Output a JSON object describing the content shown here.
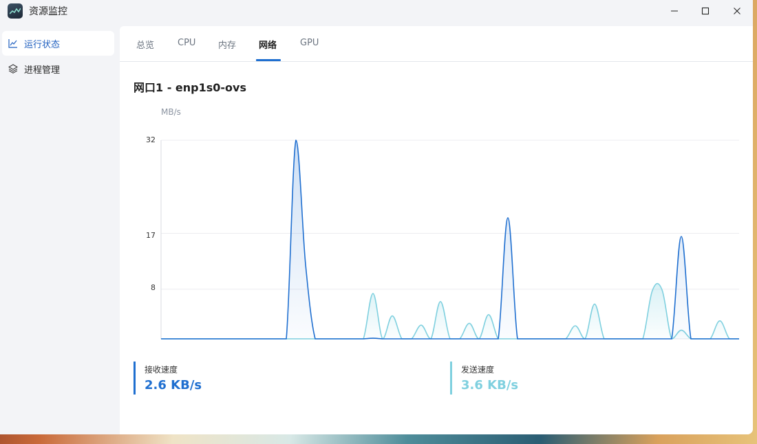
{
  "window": {
    "title": "资源监控",
    "app_icon": "monitor-chart-icon",
    "controls": [
      "minimize-icon",
      "maximize-icon",
      "close-icon"
    ]
  },
  "sidebar": {
    "items": [
      {
        "label": "运行状态",
        "icon": "line-chart-icon",
        "active": true
      },
      {
        "label": "进程管理",
        "icon": "layers-icon",
        "active": false
      }
    ]
  },
  "tabs": [
    {
      "label": "总览"
    },
    {
      "label": "CPU"
    },
    {
      "label": "内存"
    },
    {
      "label": "网络",
      "active": true
    },
    {
      "label": "GPU"
    }
  ],
  "network": {
    "interface_title": "网口1 - enp1s0-ovs",
    "unit": "MB/s",
    "receive_label": "接收速度",
    "receive_value": "2.6 KB/s",
    "send_label": "发送速度",
    "send_value": "3.6 KB/s"
  },
  "colors": {
    "accent": "#1f6fd0",
    "receive": "#1f6fd0",
    "send": "#7fd0df",
    "grid": "#ececf0"
  },
  "chart_data": {
    "type": "area",
    "ylabel": "MB/s",
    "yticks": [
      32,
      17,
      8
    ],
    "ylim": [
      0,
      32
    ],
    "xlim": [
      0,
      60
    ],
    "grid": true,
    "series": [
      {
        "name": "接收速度",
        "color": "#1f6fd0",
        "values": [
          0,
          0,
          0,
          0,
          0,
          0,
          0,
          0,
          0,
          0,
          0,
          0,
          0,
          0,
          32,
          12,
          0,
          0,
          0,
          0,
          0,
          0,
          0.1,
          0,
          0,
          0,
          0,
          0,
          0,
          0,
          0,
          0,
          0,
          0,
          0,
          0,
          19.5,
          0,
          0,
          0,
          0,
          0,
          0,
          0,
          0,
          0,
          0,
          0,
          0,
          0,
          0,
          0,
          0,
          0,
          16.5,
          0,
          0,
          0,
          0,
          0,
          0
        ]
      },
      {
        "name": "发送速度",
        "color": "#7fd0df",
        "values": [
          0,
          0,
          0,
          0,
          0,
          0,
          0,
          0,
          0,
          0,
          0,
          0,
          0,
          0,
          0,
          0,
          0,
          0,
          0,
          0,
          0,
          0,
          7.3,
          0,
          3.7,
          0,
          0,
          2.2,
          0,
          6,
          0,
          0,
          2.5,
          0,
          3.9,
          0,
          0,
          0,
          0,
          0,
          0,
          0,
          0,
          2.1,
          0,
          5.6,
          0,
          0,
          0,
          0,
          0,
          7.8,
          7.9,
          0,
          1.4,
          0,
          0,
          0,
          2.9,
          0,
          0
        ]
      }
    ]
  }
}
